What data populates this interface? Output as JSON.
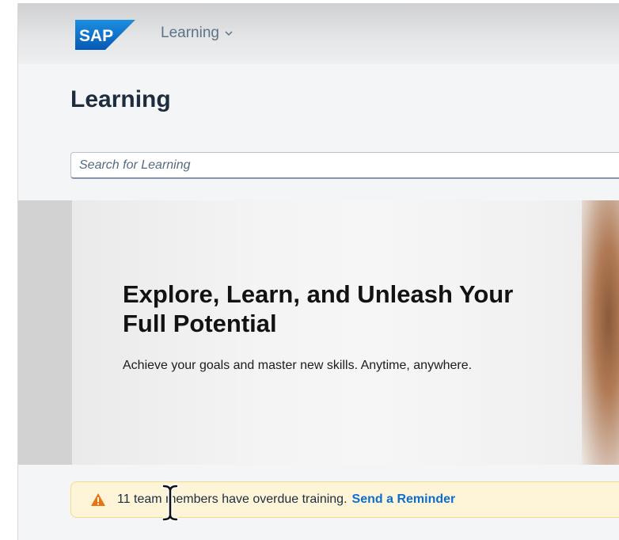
{
  "shellbar": {
    "logo_text": "SAP",
    "app_menu_label": "Learning",
    "brand_color": "#0a6ed1"
  },
  "page": {
    "title": "Learning"
  },
  "search": {
    "placeholder": "Search for Learning"
  },
  "hero": {
    "title": "Explore, Learn, and Unleash Your Full Potential",
    "subtitle": "Achieve your goals and master new skills. Anytime, anywhere."
  },
  "alert": {
    "icon": "warning-icon",
    "message": "11 team members have overdue training.",
    "link_label": "Send a Reminder",
    "icon_color": "#e9730c"
  }
}
